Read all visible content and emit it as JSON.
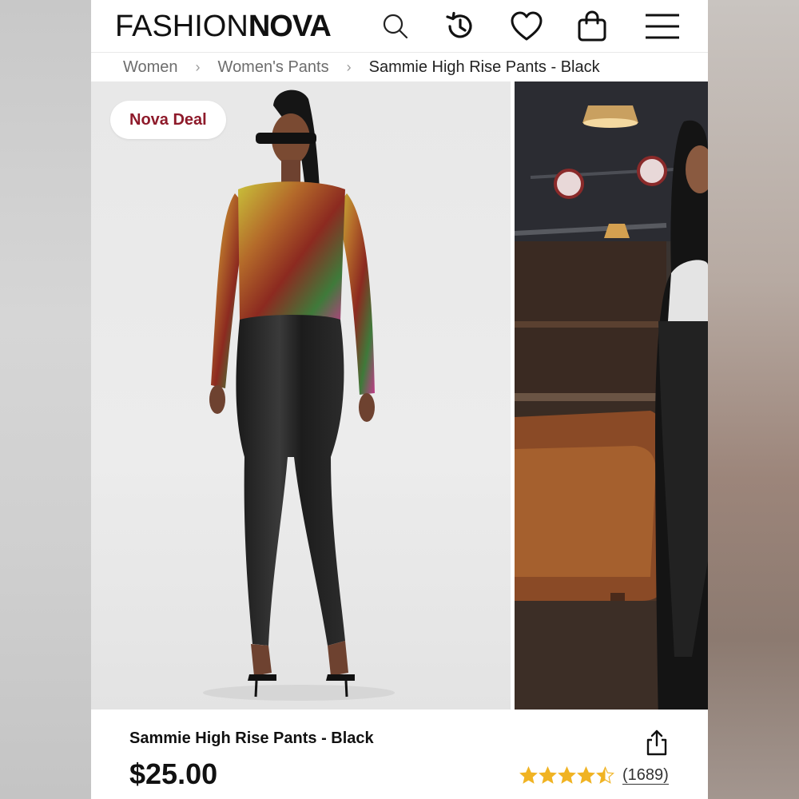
{
  "header": {
    "logo_thin": "FASHION",
    "logo_bold": "NOVA",
    "icons": [
      "search-icon",
      "history-icon",
      "heart-icon",
      "shopping-bag-icon",
      "menu-icon"
    ]
  },
  "breadcrumb": [
    {
      "label": "Women"
    },
    {
      "label": "Women's Pants"
    },
    {
      "label": "Sammie High Rise Pants - Black"
    }
  ],
  "gallery": {
    "badge": "Nova Deal",
    "images": [
      "model-front-photo",
      "model-lifestyle-photo"
    ]
  },
  "product": {
    "title": "Sammie High Rise Pants - Black",
    "price": "$25.00",
    "rating": 4.5,
    "rating_max": 5,
    "review_count": "(1689)"
  },
  "colors": {
    "badge_text": "#8e1a2a",
    "star": "#f0b323",
    "text": "#111111"
  }
}
